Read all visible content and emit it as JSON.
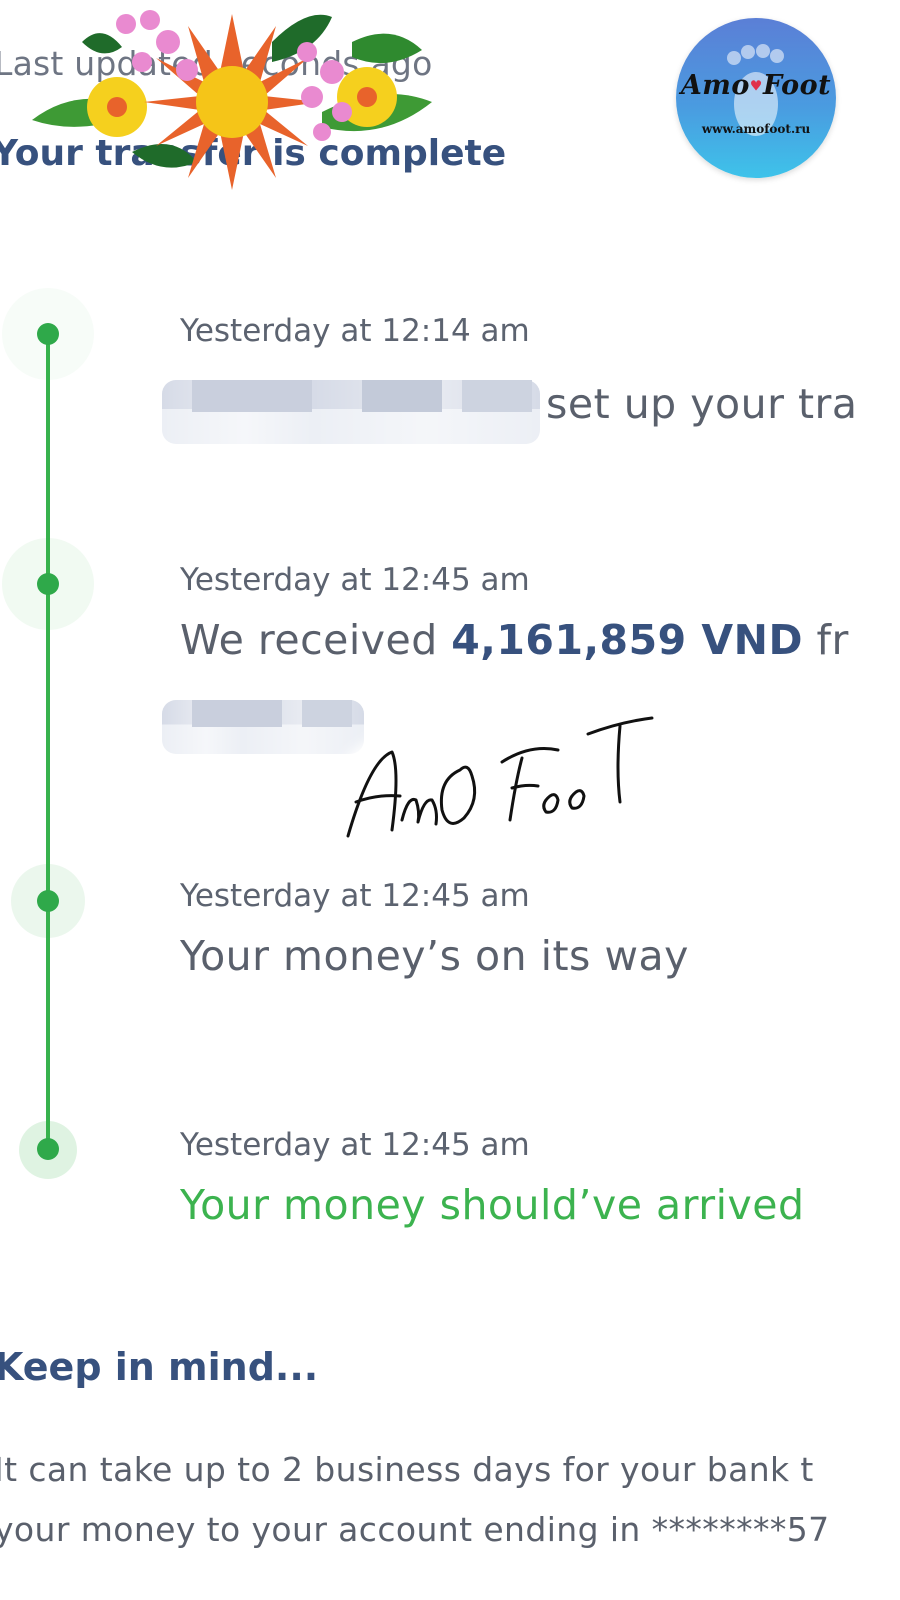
{
  "header": {
    "last_updated": "Last updated seconds ago",
    "headline": "Your transfer is complete"
  },
  "timeline": {
    "accent_color": "#37b24d",
    "events": [
      {
        "time": "Yesterday at 12:14 am",
        "text": "set up your tra"
      },
      {
        "time": "Yesterday at 12:45 am",
        "text_prefix": "We received ",
        "amount": "4,161,859 VND",
        "text_suffix": " fr"
      },
      {
        "time": "Yesterday at 12:45 am",
        "text": "Your money’s on its way"
      },
      {
        "time": "Yesterday at 12:45 am",
        "text": "Your money should’ve arrived",
        "status_color": "#3cb34f"
      }
    ]
  },
  "keep_in_mind": {
    "title": "Keep in mind...",
    "lines": [
      "It can take up to 2 business days for your bank t",
      "your money to your account ending in ********57"
    ]
  },
  "watermark": {
    "logo_name": "Amo Foot",
    "logo_url": "www.amofoot.ru",
    "signature": "AmO Foot"
  }
}
